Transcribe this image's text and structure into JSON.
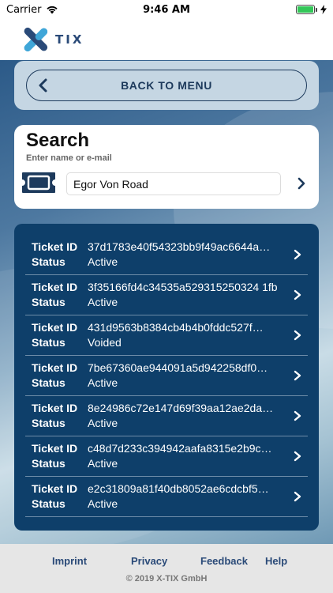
{
  "status_bar": {
    "carrier": "Carrier",
    "time": "9:46 AM",
    "icons": [
      "wifi-icon",
      "battery-icon",
      "charging-icon"
    ],
    "battery_color": "#34c759"
  },
  "header": {
    "logo_text": "TIX",
    "brand_colors": [
      "#2a4a78",
      "#3fa6d8"
    ]
  },
  "back_button": {
    "label": "BACK TO MENU",
    "icon": "chevron-left-icon"
  },
  "search": {
    "title": "Search",
    "subtitle": "Enter name or e-mail",
    "value": "Egor Von Road",
    "icon": "ticket-icon",
    "go_icon": "chevron-right-icon"
  },
  "tickets": {
    "id_label": "Ticket ID",
    "status_label": "Status",
    "items": [
      {
        "id": "37d1783e40f54323bb9f49ac6644a…",
        "status": "Active"
      },
      {
        "id": "3f35166fd4c34535a529315250324 1fb",
        "status": "Active"
      },
      {
        "id": "431d9563b8384cb4b4b0fddc527f…",
        "status": "Voided"
      },
      {
        "id": "7be67360ae944091a5d942258df0…",
        "status": "Active"
      },
      {
        "id": "8e24986c72e147d69f39aa12ae2da…",
        "status": "Active"
      },
      {
        "id": "c48d7d233c394942aafa8315e2b9c…",
        "status": "Active"
      },
      {
        "id": "e2c31809a81f40db8052ae6cdcbf5…",
        "status": "Active"
      }
    ]
  },
  "footer": {
    "links": [
      "Imprint",
      "Privacy",
      "Feedback",
      "Help"
    ],
    "copyright": "© 2019 X-TIX GmbH"
  },
  "colors": {
    "panel_dark": "#0e3f6a",
    "accent_navy": "#1d3a5c",
    "footer_bg": "#e6e6e6"
  }
}
